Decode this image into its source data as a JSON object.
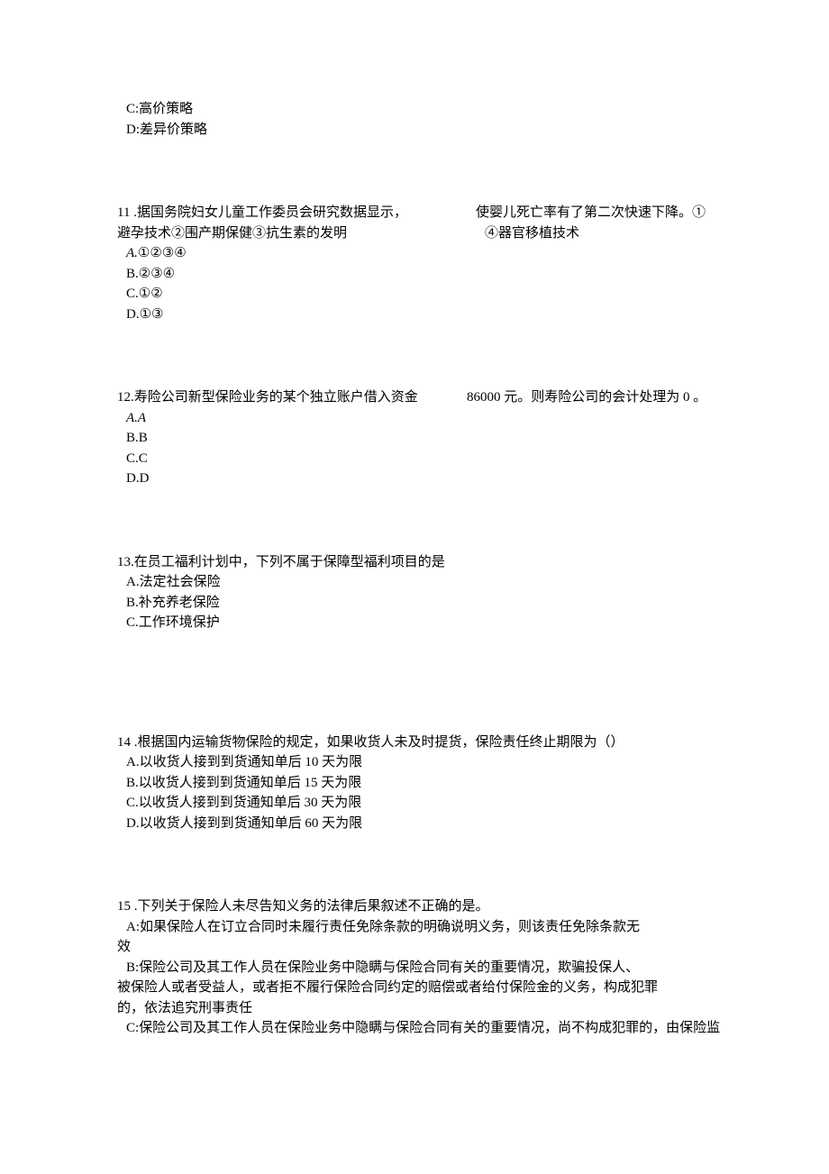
{
  "top": {
    "c": "C:高价策略",
    "d": "D:差异价策略"
  },
  "q11": {
    "stem_left_l1": "11 .据国务院妇女儿童工作委员会研究数据显示，",
    "stem_left_l2": "避孕技术②围产期保健③抗生素的发明",
    "stem_right_l1": "使婴儿死亡率有了第二次快速下降。①",
    "stem_right_l2": "④器官移植技术",
    "a_prefix": "A.",
    "a": "①②③④",
    "b": "B.②③④",
    "c": "C.①②",
    "d": "D.①③"
  },
  "q12": {
    "stem_left": "12.寿险公司新型保险业务的某个独立账户借入资金",
    "stem_right": "86000 元。则寿险公司的会计处理为  0  。",
    "a_prefix": "A.A",
    "b": "B.B",
    "c": "C.C",
    "d": "D.D"
  },
  "q13": {
    "stem": "13.在员工福利计划中，下列不属于保障型福利项目的是",
    "a": "A.法定社会保险",
    "b": "B.补充养老保险",
    "c": "C.工作环境保护"
  },
  "q14": {
    "stem": "14 .根据国内运输货物保险的规定，如果收货人未及时提货，保险责任终止期限为（）",
    "a": "A.以收货人接到到货通知单后 10 天为限",
    "b": "B.以收货人接到到货通知单后 15 天为限",
    "c": "C.以收货人接到到货通知单后 30 天为限",
    "d": "D.以收货人接到到货通知单后 60 天为限"
  },
  "q15": {
    "stem": "15 .下列关于保险人未尽告知义务的法律后果叙述不正确的是。",
    "a_l1": "A:如果保险人在订立合同时未履行责任免除条款的明确说明义务，则该责任免除条款无",
    "a_l2": "效",
    "b_l1": "B:保险公司及其工作人员在保险业务中隐瞒与保险合同有关的重要情况，欺骗投保人、",
    "b_l2": "被保险人或者受益人，或者拒不履行保险合同约定的赔偿或者给付保险金的义务，构成犯罪",
    "b_l3": "的，依法追究刑事责任",
    "c_l1": "C:保险公司及其工作人员在保险业务中隐瞒与保险合同有关的重要情况，尚不构成犯罪的，由保险监"
  }
}
